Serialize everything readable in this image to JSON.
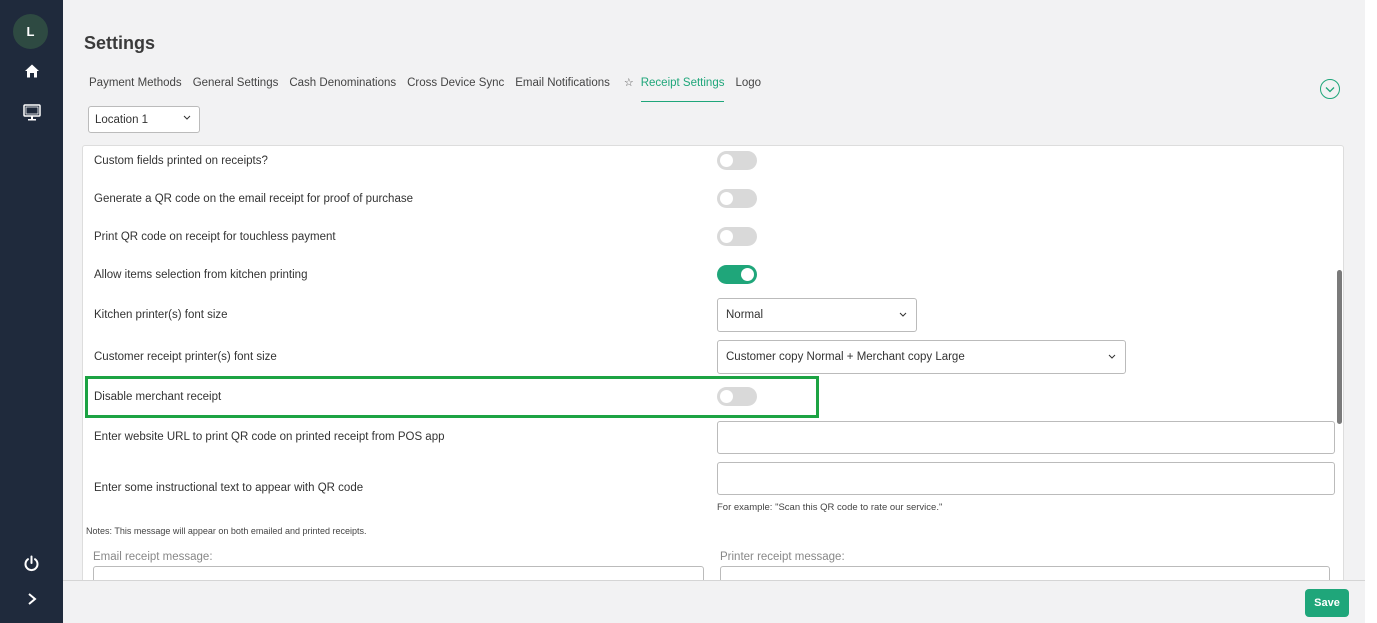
{
  "sidebar": {
    "avatar_initial": "L",
    "icons": [
      "home-icon",
      "monitor-icon",
      "power-icon",
      "chevron-right-icon"
    ]
  },
  "page": {
    "title": "Settings",
    "tabs": [
      {
        "label": "Payment Methods"
      },
      {
        "label": "General Settings"
      },
      {
        "label": "Cash Denominations"
      },
      {
        "label": "Cross Device Sync"
      },
      {
        "label": "Email Notifications"
      },
      {
        "label": "Receipt Settings",
        "active": true
      },
      {
        "label": "Logo"
      }
    ],
    "location_select": "Location 1"
  },
  "settings": {
    "custom_fields": {
      "label": "Custom fields printed on receipts?",
      "on": false
    },
    "qr_email": {
      "label": "Generate a QR code on the email receipt for proof of purchase",
      "on": false
    },
    "qr_touchless": {
      "label": "Print QR code on receipt for touchless payment",
      "on": false
    },
    "kitchen_selection": {
      "label": "Allow items selection from kitchen printing",
      "on": true
    },
    "kitchen_font": {
      "label": "Kitchen printer(s) font size",
      "value": "Normal"
    },
    "customer_font": {
      "label": "Customer receipt printer(s) font size",
      "value": "Customer copy Normal + Merchant copy Large"
    },
    "disable_merchant": {
      "label": "Disable merchant receipt",
      "on": false
    },
    "website_url": {
      "label": "Enter website URL to print QR code on printed receipt from POS app",
      "value": ""
    },
    "instructional_text": {
      "label": "Enter some instructional text to appear with QR code",
      "value": "",
      "hint": "For example: \"Scan this QR code to rate our service.\""
    },
    "notes": "Notes: This message will appear on both emailed and printed receipts.",
    "email_message_label": "Email receipt message:",
    "printer_message_label": "Printer receipt message:"
  },
  "footer": {
    "save_label": "Save"
  },
  "colors": {
    "accent": "#1fa67a",
    "highlight": "#1ca343",
    "sidebar": "#1f2a3c"
  }
}
